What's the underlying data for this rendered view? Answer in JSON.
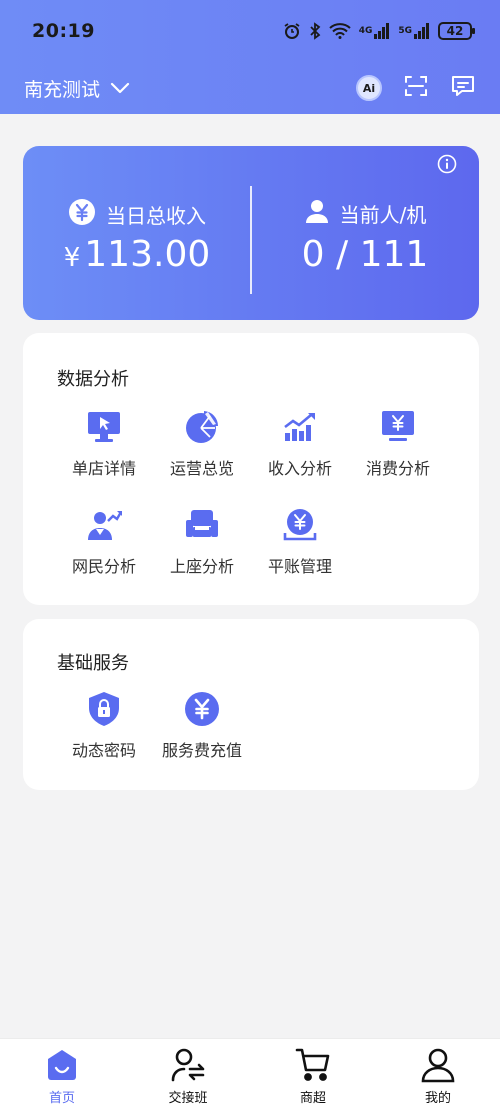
{
  "status_bar": {
    "time": "20:19",
    "network_1": "4G",
    "network_2": "5G",
    "battery": "42",
    "icons": [
      "alarm-icon",
      "bluetooth-icon",
      "wifi-icon",
      "signal-icon",
      "battery-icon"
    ]
  },
  "header": {
    "store_name": "南充测试",
    "ai_label": "Ai",
    "icons": [
      "chevron-down-icon",
      "ai-icon",
      "scan-icon",
      "message-icon"
    ]
  },
  "summary": {
    "income_label": "当日总收入",
    "income_currency": "¥",
    "income_value": "113.00",
    "users_label": "当前人/机",
    "users_value": "0 / 111"
  },
  "analysis": {
    "title": "数据分析",
    "items": [
      {
        "label": "单店详情",
        "icon": "monitor-cursor-icon"
      },
      {
        "label": "运营总览",
        "icon": "pie-chart-icon"
      },
      {
        "label": "收入分析",
        "icon": "bar-trend-icon"
      },
      {
        "label": "消费分析",
        "icon": "monitor-yen-icon"
      },
      {
        "label": "网民分析",
        "icon": "users-chart-icon"
      },
      {
        "label": "上座分析",
        "icon": "sofa-icon"
      },
      {
        "label": "平账管理",
        "icon": "yen-coin-icon"
      }
    ]
  },
  "basic": {
    "title": "基础服务",
    "items": [
      {
        "label": "动态密码",
        "icon": "shield-lock-icon"
      },
      {
        "label": "服务费充值",
        "icon": "yen-circle-icon"
      }
    ]
  },
  "nav": {
    "items": [
      {
        "label": "首页",
        "icon": "home-icon",
        "active": true
      },
      {
        "label": "交接班",
        "icon": "user-swap-icon",
        "active": false
      },
      {
        "label": "商超",
        "icon": "cart-icon",
        "active": false
      },
      {
        "label": "我的",
        "icon": "person-icon",
        "active": false
      }
    ]
  },
  "colors": {
    "accent": "#5a6cf0",
    "card_gradient_start": "#6d8ef6",
    "card_gradient_end": "#5d68ee"
  }
}
